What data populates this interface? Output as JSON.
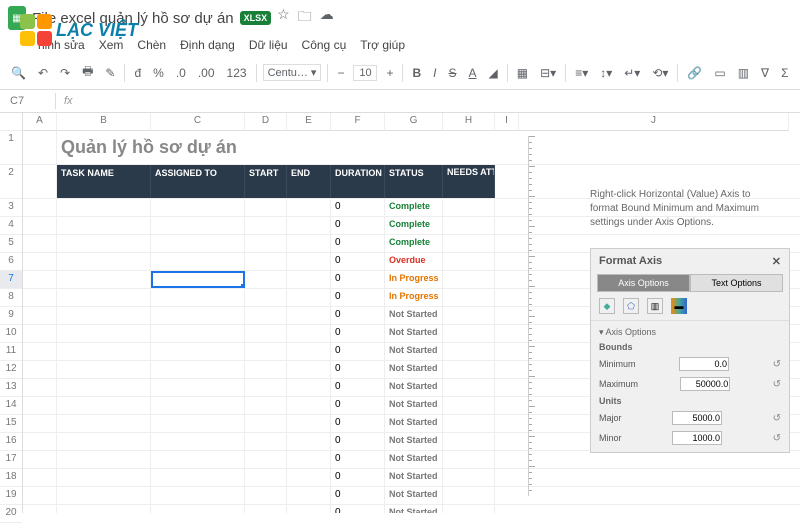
{
  "doc": {
    "title": "File excel quản lý hồ sơ dự án",
    "badge": "XLSX"
  },
  "menu": {
    "m1": "hỉnh sửa",
    "m2": "Xem",
    "m3": "Chèn",
    "m4": "Định dạng",
    "m5": "Dữ liệu",
    "m6": "Công cụ",
    "m7": "Trợ giúp"
  },
  "toolbar": {
    "font": "Centu…",
    "size": "10"
  },
  "namebox": "C7",
  "cols": {
    "A": "A",
    "B": "B",
    "C": "C",
    "D": "D",
    "E": "E",
    "F": "F",
    "G": "G",
    "H": "H",
    "I": "I",
    "J": "J"
  },
  "sheet_title": "Quản lý hồ sơ dự án",
  "headers": {
    "task": "TASK NAME",
    "assigned": "ASSIGNED TO",
    "start": "START",
    "end": "END",
    "duration": "DURATION",
    "status": "STATUS",
    "needs": "NEEDS ATTENTION"
  },
  "rows": [
    {
      "n": "3",
      "dur": "0",
      "status": "Complete",
      "cls": "st-complete"
    },
    {
      "n": "4",
      "dur": "0",
      "status": "Complete",
      "cls": "st-complete"
    },
    {
      "n": "5",
      "dur": "0",
      "status": "Complete",
      "cls": "st-complete"
    },
    {
      "n": "6",
      "dur": "0",
      "status": "Overdue",
      "cls": "st-overdue"
    },
    {
      "n": "7",
      "dur": "0",
      "status": "In Progress",
      "cls": "st-progress",
      "sel": true
    },
    {
      "n": "8",
      "dur": "0",
      "status": "In Progress",
      "cls": "st-progress"
    },
    {
      "n": "9",
      "dur": "0",
      "status": "Not Started",
      "cls": "st-notstarted"
    },
    {
      "n": "10",
      "dur": "0",
      "status": "Not Started",
      "cls": "st-notstarted"
    },
    {
      "n": "11",
      "dur": "0",
      "status": "Not Started",
      "cls": "st-notstarted"
    },
    {
      "n": "12",
      "dur": "0",
      "status": "Not Started",
      "cls": "st-notstarted"
    },
    {
      "n": "13",
      "dur": "0",
      "status": "Not Started",
      "cls": "st-notstarted"
    },
    {
      "n": "14",
      "dur": "0",
      "status": "Not Started",
      "cls": "st-notstarted"
    },
    {
      "n": "15",
      "dur": "0",
      "status": "Not Started",
      "cls": "st-notstarted"
    },
    {
      "n": "16",
      "dur": "0",
      "status": "Not Started",
      "cls": "st-notstarted"
    },
    {
      "n": "17",
      "dur": "0",
      "status": "Not Started",
      "cls": "st-notstarted"
    },
    {
      "n": "18",
      "dur": "0",
      "status": "Not Started",
      "cls": "st-notstarted"
    },
    {
      "n": "19",
      "dur": "0",
      "status": "Not Started",
      "cls": "st-notstarted"
    },
    {
      "n": "20",
      "dur": "0",
      "status": "Not Started",
      "cls": "st-notstarted"
    }
  ],
  "logo": {
    "text": "LẠC VIỆT"
  },
  "hint": "Right-click Horizontal (Value) Axis to format Bound Minimum and Maximum settings under Axis Options.",
  "panel": {
    "title": "Format Axis",
    "tab1": "Axis Options",
    "tab2": "Text Options",
    "section": "Axis Options",
    "bounds": "Bounds",
    "min_l": "Minimum",
    "min_v": "0.0",
    "max_l": "Maximum",
    "max_v": "50000.0",
    "units": "Units",
    "maj_l": "Major",
    "maj_v": "5000.0",
    "mnr_l": "Minor",
    "mnr_v": "1000.0"
  }
}
